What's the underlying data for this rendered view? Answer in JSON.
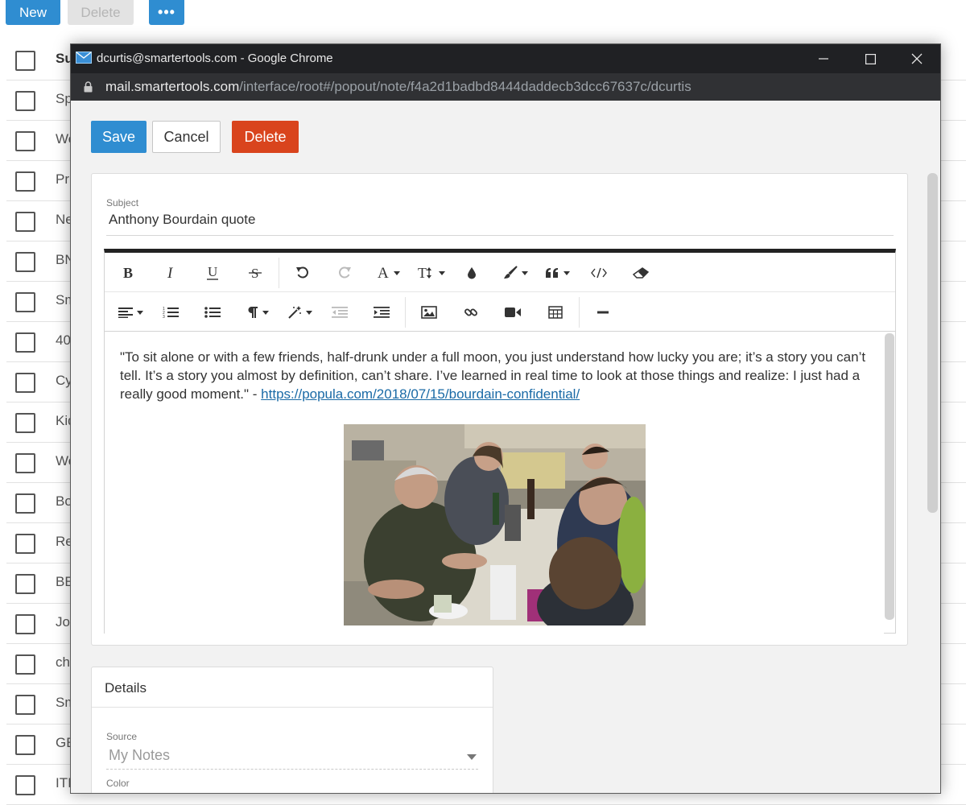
{
  "background": {
    "toolbar": {
      "new_label": "New",
      "delete_label": "Delete",
      "more_label": "•••"
    },
    "list": {
      "header": "Su",
      "rows": [
        "Sp",
        "We",
        "Pr",
        "Ne",
        "BN",
        "Sm",
        "40",
        "Cy",
        "Kid",
        "We",
        "Bo",
        "Re",
        "BE",
        "Jo",
        "ch",
        "Sm",
        "GE",
        "ITI"
      ]
    }
  },
  "window": {
    "title": "dcurtis@smartertools.com - Google Chrome",
    "url_host": "mail.smartertools.com",
    "url_path": "/interface/root#/popout/note/f4a2d1badbd8444daddecb3dcc67637c/dcurtis"
  },
  "actions": {
    "save": "Save",
    "cancel": "Cancel",
    "delete": "Delete"
  },
  "note": {
    "subject_label": "Subject",
    "subject": "Anthony Bourdain quote",
    "quote": "\"To sit alone or with a few friends, half-drunk under a full moon, you just understand how lucky you are; it’s a story you can’t tell. It’s a story you almost by definition, can’t share. I’ve learned in real time to look at those things and realize: I just had a really good moment.\" - ",
    "link": "https://popula.com/2018/07/15/bourdain-confidential/"
  },
  "toolbar": {
    "row1": [
      "bold-icon",
      "italic-icon",
      "underline-icon",
      "strikethrough-icon",
      "undo-icon",
      "redo-icon",
      "font-color-icon",
      "font-size-icon",
      "fill-color-icon",
      "paint-brush-icon",
      "quote-icon",
      "code-view-icon",
      "eraser-icon"
    ],
    "row2": [
      "align-icon",
      "ordered-list-icon",
      "unordered-list-icon",
      "paragraph-icon",
      "magic-wand-icon",
      "outdent-icon",
      "indent-icon",
      "image-icon",
      "link-icon",
      "video-icon",
      "table-icon",
      "horizontal-rule-icon"
    ]
  },
  "details": {
    "title": "Details",
    "source_label": "Source",
    "source_value": "My Notes",
    "color_label": "Color"
  }
}
